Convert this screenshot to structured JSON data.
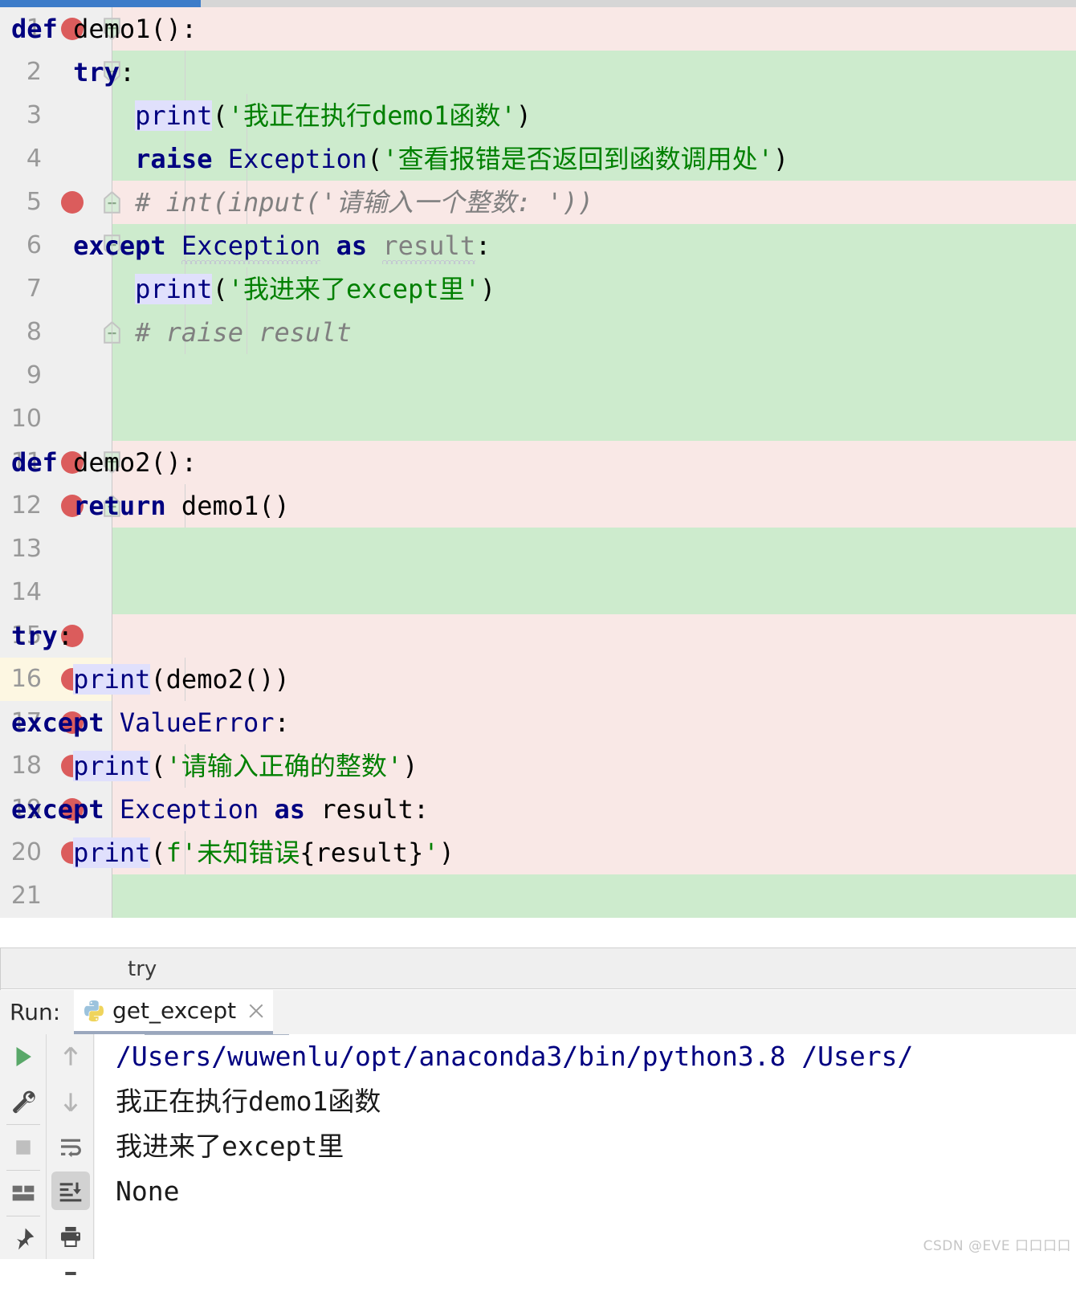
{
  "editor": {
    "lines": [
      {
        "num": "1",
        "breakpoint": true,
        "fold": "start",
        "bg": "pink",
        "indent": 0,
        "tokens": [
          {
            "t": "kw",
            "v": "def"
          },
          {
            "t": "plain",
            "v": " "
          },
          {
            "t": "id",
            "v": "demo1():"
          }
        ]
      },
      {
        "num": "2",
        "breakpoint": false,
        "fold": "start",
        "bg": "green",
        "indent": 1,
        "tokens": [
          {
            "t": "plain",
            "v": "    "
          },
          {
            "t": "kw",
            "v": "try"
          },
          {
            "t": "id",
            "v": ":"
          }
        ]
      },
      {
        "num": "3",
        "breakpoint": false,
        "fold": "none",
        "bg": "green",
        "indent": 2,
        "tokens": [
          {
            "t": "plain",
            "v": "        "
          },
          {
            "t": "fn",
            "v": "print"
          },
          {
            "t": "id",
            "v": "("
          },
          {
            "t": "str",
            "v": "'我正在执行demo1函数'"
          },
          {
            "t": "id",
            "v": ")"
          }
        ]
      },
      {
        "num": "4",
        "breakpoint": false,
        "fold": "none",
        "bg": "green",
        "indent": 2,
        "tokens": [
          {
            "t": "plain",
            "v": "        "
          },
          {
            "t": "kw",
            "v": "raise"
          },
          {
            "t": "plain",
            "v": " "
          },
          {
            "t": "kwn",
            "v": "Exception"
          },
          {
            "t": "id",
            "v": "("
          },
          {
            "t": "str",
            "v": "'查看报错是否返回到函数调用处'"
          },
          {
            "t": "id",
            "v": ")"
          }
        ]
      },
      {
        "num": "5",
        "breakpoint": true,
        "fold": "end",
        "bg": "pink",
        "indent": 2,
        "tokens": [
          {
            "t": "plain",
            "v": "        "
          },
          {
            "t": "com",
            "v": "# int(input('请输入一个整数: '))"
          }
        ]
      },
      {
        "num": "6",
        "breakpoint": false,
        "fold": "start",
        "bg": "green",
        "indent": 1,
        "tokens": [
          {
            "t": "plain",
            "v": "    "
          },
          {
            "t": "kw",
            "v": "except"
          },
          {
            "t": "plain",
            "v": " "
          },
          {
            "t": "kwn-wavy",
            "v": "Exception"
          },
          {
            "t": "plain",
            "v": " "
          },
          {
            "t": "kw",
            "v": "as"
          },
          {
            "t": "plain",
            "v": " "
          },
          {
            "t": "dim-wavy",
            "v": "result"
          },
          {
            "t": "id",
            "v": ":"
          }
        ]
      },
      {
        "num": "7",
        "breakpoint": false,
        "fold": "none",
        "bg": "green",
        "indent": 2,
        "tokens": [
          {
            "t": "plain",
            "v": "        "
          },
          {
            "t": "fn",
            "v": "print"
          },
          {
            "t": "id",
            "v": "("
          },
          {
            "t": "str",
            "v": "'我进来了except里'"
          },
          {
            "t": "id",
            "v": ")"
          }
        ]
      },
      {
        "num": "8",
        "breakpoint": false,
        "fold": "end",
        "bg": "green",
        "indent": 2,
        "tokens": [
          {
            "t": "plain",
            "v": "        "
          },
          {
            "t": "com",
            "v": "# raise result"
          }
        ]
      },
      {
        "num": "9",
        "breakpoint": false,
        "fold": "none",
        "bg": "green",
        "indent": 0,
        "tokens": []
      },
      {
        "num": "10",
        "breakpoint": false,
        "fold": "none",
        "bg": "green",
        "indent": 0,
        "tokens": []
      },
      {
        "num": "11",
        "breakpoint": true,
        "fold": "start",
        "bg": "pink",
        "indent": 0,
        "tokens": [
          {
            "t": "kw",
            "v": "def"
          },
          {
            "t": "plain",
            "v": " "
          },
          {
            "t": "id",
            "v": "demo2():"
          }
        ]
      },
      {
        "num": "12",
        "breakpoint": true,
        "fold": "end",
        "bg": "pink",
        "indent": 1,
        "tokens": [
          {
            "t": "plain",
            "v": "    "
          },
          {
            "t": "kw",
            "v": "return"
          },
          {
            "t": "plain",
            "v": " "
          },
          {
            "t": "id",
            "v": "demo1()"
          }
        ]
      },
      {
        "num": "13",
        "breakpoint": false,
        "fold": "none",
        "bg": "green",
        "indent": 0,
        "tokens": []
      },
      {
        "num": "14",
        "breakpoint": false,
        "fold": "none",
        "bg": "green",
        "indent": 0,
        "tokens": []
      },
      {
        "num": "15",
        "breakpoint": true,
        "fold": "none",
        "bg": "pink",
        "indent": 0,
        "tokens": [
          {
            "t": "kw",
            "v": "try"
          },
          {
            "t": "id",
            "v": ":"
          }
        ]
      },
      {
        "num": "16",
        "breakpoint": true,
        "fold": "none",
        "bg": "pink",
        "indent": 1,
        "current": true,
        "tokens": [
          {
            "t": "plain",
            "v": "    "
          },
          {
            "t": "fn",
            "v": "print"
          },
          {
            "t": "id",
            "v": "(demo2())"
          }
        ]
      },
      {
        "num": "17",
        "breakpoint": true,
        "fold": "none",
        "bg": "pink",
        "indent": 0,
        "tokens": [
          {
            "t": "kw",
            "v": "except"
          },
          {
            "t": "plain",
            "v": " "
          },
          {
            "t": "kwn",
            "v": "ValueError"
          },
          {
            "t": "id",
            "v": ":"
          }
        ]
      },
      {
        "num": "18",
        "breakpoint": true,
        "fold": "none",
        "bg": "pink",
        "indent": 1,
        "tokens": [
          {
            "t": "plain",
            "v": "    "
          },
          {
            "t": "fn",
            "v": "print"
          },
          {
            "t": "id",
            "v": "("
          },
          {
            "t": "str",
            "v": "'请输入正确的整数'"
          },
          {
            "t": "id",
            "v": ")"
          }
        ]
      },
      {
        "num": "19",
        "breakpoint": true,
        "fold": "none",
        "bg": "pink",
        "indent": 0,
        "tokens": [
          {
            "t": "kw",
            "v": "except"
          },
          {
            "t": "plain",
            "v": " "
          },
          {
            "t": "kwn",
            "v": "Exception"
          },
          {
            "t": "plain",
            "v": " "
          },
          {
            "t": "kw",
            "v": "as"
          },
          {
            "t": "plain",
            "v": " "
          },
          {
            "t": "id",
            "v": "result:"
          }
        ]
      },
      {
        "num": "20",
        "breakpoint": true,
        "fold": "none",
        "bg": "pink",
        "indent": 1,
        "tokens": [
          {
            "t": "plain",
            "v": "    "
          },
          {
            "t": "fn",
            "v": "print"
          },
          {
            "t": "id",
            "v": "("
          },
          {
            "t": "str",
            "v": "f'未知错误"
          },
          {
            "t": "id",
            "v": "{result}"
          },
          {
            "t": "str",
            "v": "'"
          },
          {
            "t": "id",
            "v": ")"
          }
        ]
      },
      {
        "num": "21",
        "breakpoint": false,
        "fold": "none",
        "bg": "green",
        "indent": 0,
        "tokens": []
      }
    ]
  },
  "breadcrumb": {
    "text": "try"
  },
  "run": {
    "label": "Run:",
    "tab_name": "get_except",
    "python_icon": "python-icon",
    "close_icon": "close-icon",
    "toolbar_left": [
      {
        "name": "rerun-icon",
        "glyph": "play"
      },
      {
        "name": "settings-icon",
        "glyph": "wrench"
      },
      {
        "name": "stop-icon",
        "glyph": "square"
      },
      {
        "name": "layout-icon",
        "glyph": "layout"
      },
      {
        "name": "pin-icon",
        "glyph": "pin"
      }
    ],
    "toolbar_right": [
      {
        "name": "up-arrow-icon",
        "glyph": "up"
      },
      {
        "name": "down-arrow-icon",
        "glyph": "down"
      },
      {
        "name": "soft-wrap-icon",
        "glyph": "wrap"
      },
      {
        "name": "scroll-to-end-icon",
        "glyph": "scrollend",
        "selected": true
      },
      {
        "name": "print-icon",
        "glyph": "printer"
      },
      {
        "name": "clear-all-icon",
        "glyph": "clear"
      }
    ],
    "console": [
      {
        "kind": "path",
        "text": "/Users/wuwenlu/opt/anaconda3/bin/python3.8 /Users/"
      },
      {
        "kind": "out",
        "text": "我正在执行demo1函数"
      },
      {
        "kind": "out",
        "text": "我进来了except里"
      },
      {
        "kind": "out",
        "text": "None"
      }
    ]
  },
  "watermark": {
    "text": "CSDN @EVE 口口口口"
  },
  "colors": {
    "breakpoint": "#db5c5c",
    "added_line": "#cdebcd",
    "modified_line": "#f9e8e6",
    "current_line_gutter": "#fdf7e2",
    "keyword": "#000080",
    "string": "#008000",
    "comment": "#808080",
    "scrollbar": "#3d7cc9",
    "tab_underline": "#9aa7bd"
  }
}
